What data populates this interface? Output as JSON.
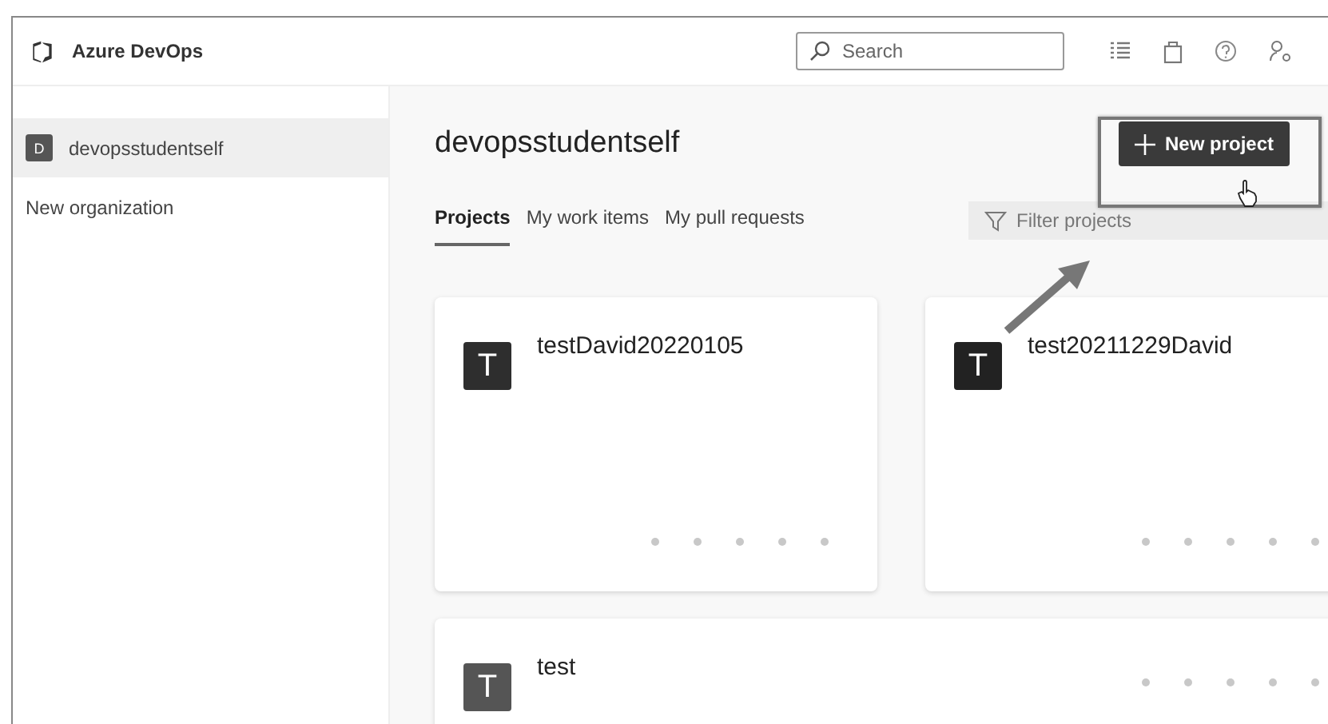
{
  "header": {
    "brand": "Azure DevOps",
    "search": {
      "placeholder": "Search"
    }
  },
  "sidebar": {
    "items": [
      {
        "initial": "D",
        "label": "devopsstudentself",
        "selected": true
      },
      {
        "label": "New organization",
        "selected": false
      }
    ]
  },
  "main": {
    "title": "devopsstudentself",
    "new_button": "New project",
    "tabs": [
      {
        "label": "Projects",
        "selected": true
      },
      {
        "label": "My work items",
        "selected": false
      },
      {
        "label": "My pull requests",
        "selected": false
      }
    ],
    "filter": {
      "placeholder": "Filter projects"
    },
    "projects": [
      {
        "initial": "T",
        "name": "testDavid20220105",
        "color": "#2e2e2e"
      },
      {
        "initial": "T",
        "name": "test20211229David",
        "color": "#222222"
      },
      {
        "initial": "T",
        "name": "test",
        "color": "#555555"
      }
    ]
  }
}
